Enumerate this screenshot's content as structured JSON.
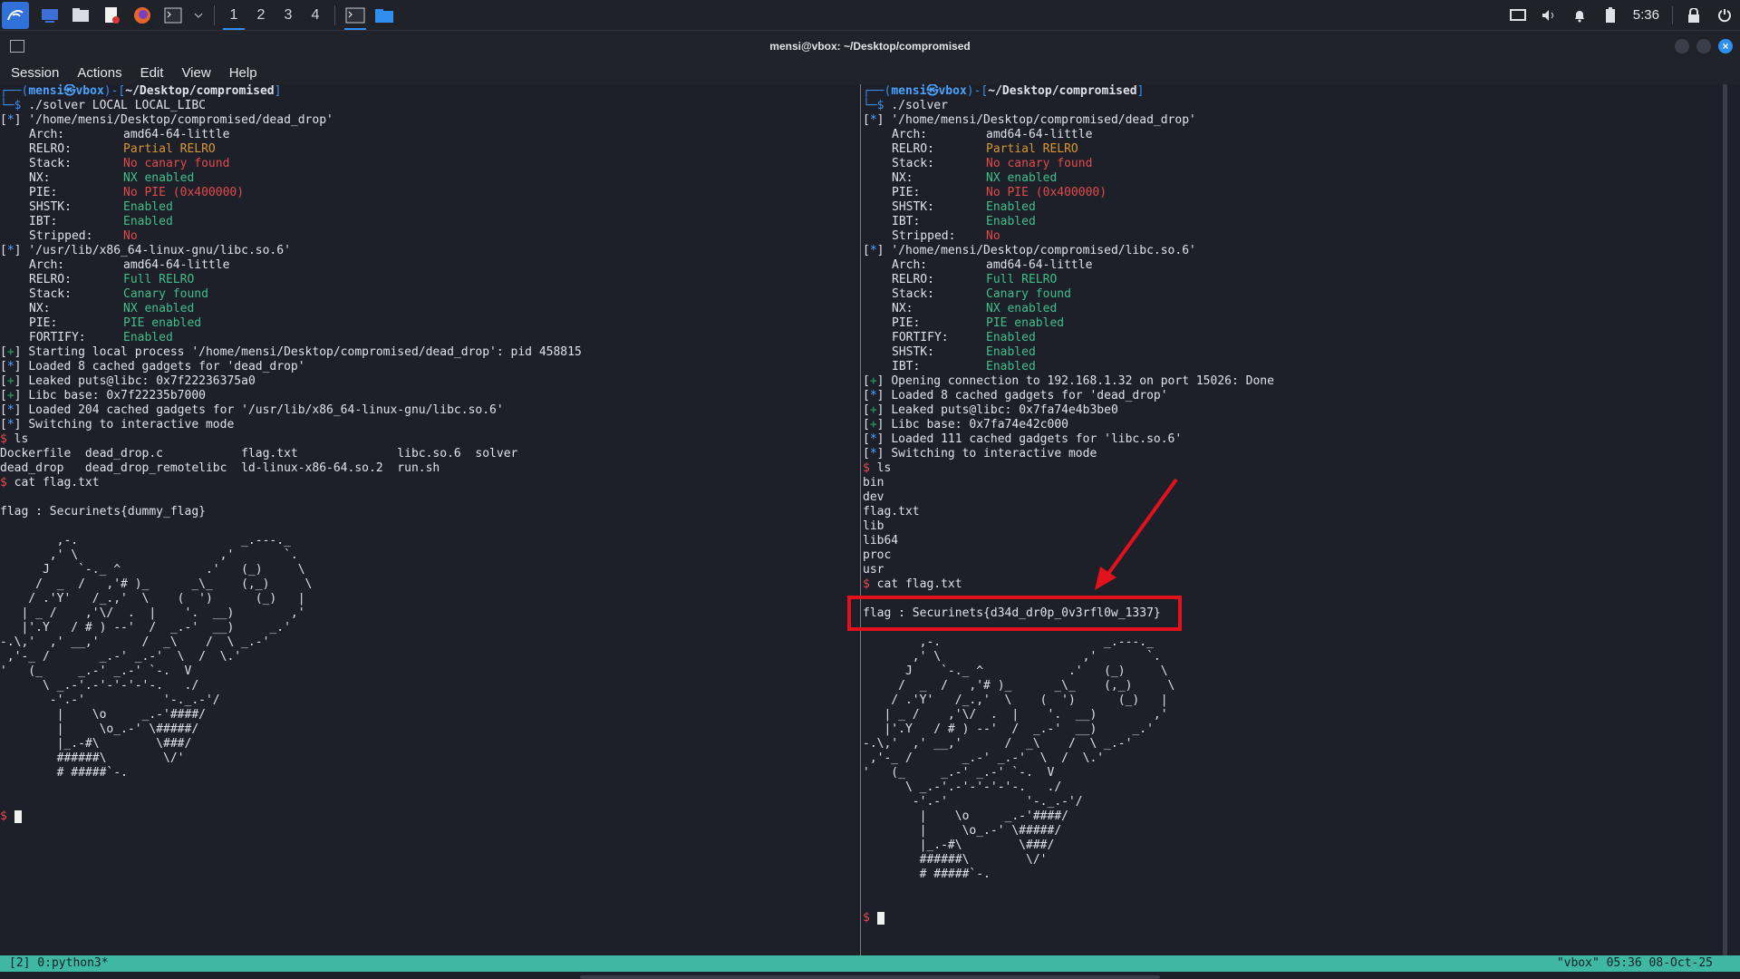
{
  "panel": {
    "workspaces": [
      "1",
      "2",
      "3",
      "4"
    ],
    "active_workspace": "1",
    "clock": "5:36"
  },
  "window": {
    "title": "mensi@vbox: ~/Desktop/compromised"
  },
  "menu": [
    "Session",
    "Actions",
    "Edit",
    "View",
    "Help"
  ],
  "left_pane": {
    "prompt_user": "mensi",
    "prompt_host": "vbox",
    "prompt_path": "~/Desktop/compromised",
    "command": "./solver LOCAL LOCAL_LIBC",
    "lines": [
      {
        "m": "*",
        "t": "'/home/mensi/Desktop/compromised/dead_drop'"
      },
      {
        "k": "Arch:",
        "v": "amd64-64-little",
        "c": "pl"
      },
      {
        "k": "RELRO:",
        "v": "Partial RELRO",
        "c": "orng"
      },
      {
        "k": "Stack:",
        "v": "No canary found",
        "c": "rd"
      },
      {
        "k": "NX:",
        "v": "NX enabled",
        "c": "gr"
      },
      {
        "k": "PIE:",
        "v": "No PIE (0x400000)",
        "c": "rd"
      },
      {
        "k": "SHSTK:",
        "v": "Enabled",
        "c": "gr"
      },
      {
        "k": "IBT:",
        "v": "Enabled",
        "c": "gr"
      },
      {
        "k": "Stripped:",
        "v": "No",
        "c": "rd"
      },
      {
        "m": "*",
        "t": "'/usr/lib/x86_64-linux-gnu/libc.so.6'"
      },
      {
        "k": "Arch:",
        "v": "amd64-64-little",
        "c": "pl"
      },
      {
        "k": "RELRO:",
        "v": "Full RELRO",
        "c": "gr"
      },
      {
        "k": "Stack:",
        "v": "Canary found",
        "c": "gr"
      },
      {
        "k": "NX:",
        "v": "NX enabled",
        "c": "gr"
      },
      {
        "k": "PIE:",
        "v": "PIE enabled",
        "c": "gr"
      },
      {
        "k": "FORTIFY:",
        "v": "Enabled",
        "c": "gr"
      },
      {
        "m": "+",
        "t": "Starting local process '/home/mensi/Desktop/compromised/dead_drop': pid 458815"
      },
      {
        "m": "*",
        "t": "Loaded 8 cached gadgets for 'dead_drop'"
      },
      {
        "m": "+",
        "t": "Leaked puts@libc: 0x7f22236375a0"
      },
      {
        "m": "+",
        "t": "Libc base: 0x7f22235b7000"
      },
      {
        "m": "*",
        "t": "Loaded 204 cached gadgets for '/usr/lib/x86_64-linux-gnu/libc.so.6'"
      },
      {
        "m": "*",
        "t": "Switching to interactive mode"
      },
      {
        "p": "ls"
      },
      {
        "t": "Dockerfile  dead_drop.c           flag.txt              libc.so.6  solver"
      },
      {
        "t": "dead_drop   dead_drop_remotelibc  ld-linux-x86-64.so.2  run.sh"
      },
      {
        "p": "cat flag.txt"
      },
      {
        "t": ""
      },
      {
        "t": "flag : Securinets{dummy_flag}"
      }
    ]
  },
  "right_pane": {
    "prompt_user": "mensi",
    "prompt_host": "vbox",
    "prompt_path": "~/Desktop/compromised",
    "command": "./solver",
    "lines": [
      {
        "m": "*",
        "t": "'/home/mensi/Desktop/compromised/dead_drop'"
      },
      {
        "k": "Arch:",
        "v": "amd64-64-little",
        "c": "pl"
      },
      {
        "k": "RELRO:",
        "v": "Partial RELRO",
        "c": "orng"
      },
      {
        "k": "Stack:",
        "v": "No canary found",
        "c": "rd"
      },
      {
        "k": "NX:",
        "v": "NX enabled",
        "c": "gr"
      },
      {
        "k": "PIE:",
        "v": "No PIE (0x400000)",
        "c": "rd"
      },
      {
        "k": "SHSTK:",
        "v": "Enabled",
        "c": "gr"
      },
      {
        "k": "IBT:",
        "v": "Enabled",
        "c": "gr"
      },
      {
        "k": "Stripped:",
        "v": "No",
        "c": "rd"
      },
      {
        "m": "*",
        "t": "'/home/mensi/Desktop/compromised/libc.so.6'"
      },
      {
        "k": "Arch:",
        "v": "amd64-64-little",
        "c": "pl"
      },
      {
        "k": "RELRO:",
        "v": "Full RELRO",
        "c": "gr"
      },
      {
        "k": "Stack:",
        "v": "Canary found",
        "c": "gr"
      },
      {
        "k": "NX:",
        "v": "NX enabled",
        "c": "gr"
      },
      {
        "k": "PIE:",
        "v": "PIE enabled",
        "c": "gr"
      },
      {
        "k": "FORTIFY:",
        "v": "Enabled",
        "c": "gr"
      },
      {
        "k": "SHSTK:",
        "v": "Enabled",
        "c": "gr"
      },
      {
        "k": "IBT:",
        "v": "Enabled",
        "c": "gr"
      },
      {
        "m": "+",
        "t": "Opening connection to 192.168.1.32 on port 15026: Done"
      },
      {
        "m": "*",
        "t": "Loaded 8 cached gadgets for 'dead_drop'"
      },
      {
        "m": "+",
        "t": "Leaked puts@libc: 0x7fa74e4b3be0"
      },
      {
        "m": "+",
        "t": "Libc base: 0x7fa74e42c000"
      },
      {
        "m": "*",
        "t": "Loaded 111 cached gadgets for 'libc.so.6'"
      },
      {
        "m": "*",
        "t": "Switching to interactive mode"
      },
      {
        "p": "ls"
      },
      {
        "t": "bin"
      },
      {
        "t": "dev"
      },
      {
        "t": "flag.txt"
      },
      {
        "t": "lib"
      },
      {
        "t": "lib64"
      },
      {
        "t": "proc"
      },
      {
        "t": "usr"
      },
      {
        "p": "cat flag.txt"
      },
      {
        "t": ""
      },
      {
        "t": "flag : Securinets{d34d_dr0p_0v3rfl0w_1337}"
      }
    ]
  },
  "ascii_art": "        ,-.                       _.---._ \n       ,' \\                    ,'       `. \n      J    `-._ ^            .'   (_)     \\\n     /  _  /   ,'# )_      _\\_    (,_)     \\\n    / .'Y'   /_.,'  \\    (  ')      (_)   |\n   | _ /    ,'\\/  .  |    '.  __)        ,'\n   |'.Y   / # ) --'  /  _.-'  __)     _.'\n-.\\,'  ,' __,'      /  _\\    /  \\ _.-'\n ,'-_ /       _.-' _.-'  \\  /  \\.'\n'   (_     _.-' _.-' `-.  V\n      \\ _.-'.-'-'-'-'-.   ./\n       -'.-'           '-._.-'/\n        |    \\o     _.-'####/\n        |     \\o_.-' \\#####/\n        |_.-#\\        \\###/\n        ######\\        \\/'\n        # #####`-.",
  "status_bar": {
    "left": "[2] 0:python3*",
    "right": "\"vbox\" 05:36 08-Oct-25"
  },
  "colors": {
    "terminal_bg": "#1e2029",
    "status_bar": "#3fb8a3",
    "annotation": "#e3111b"
  }
}
